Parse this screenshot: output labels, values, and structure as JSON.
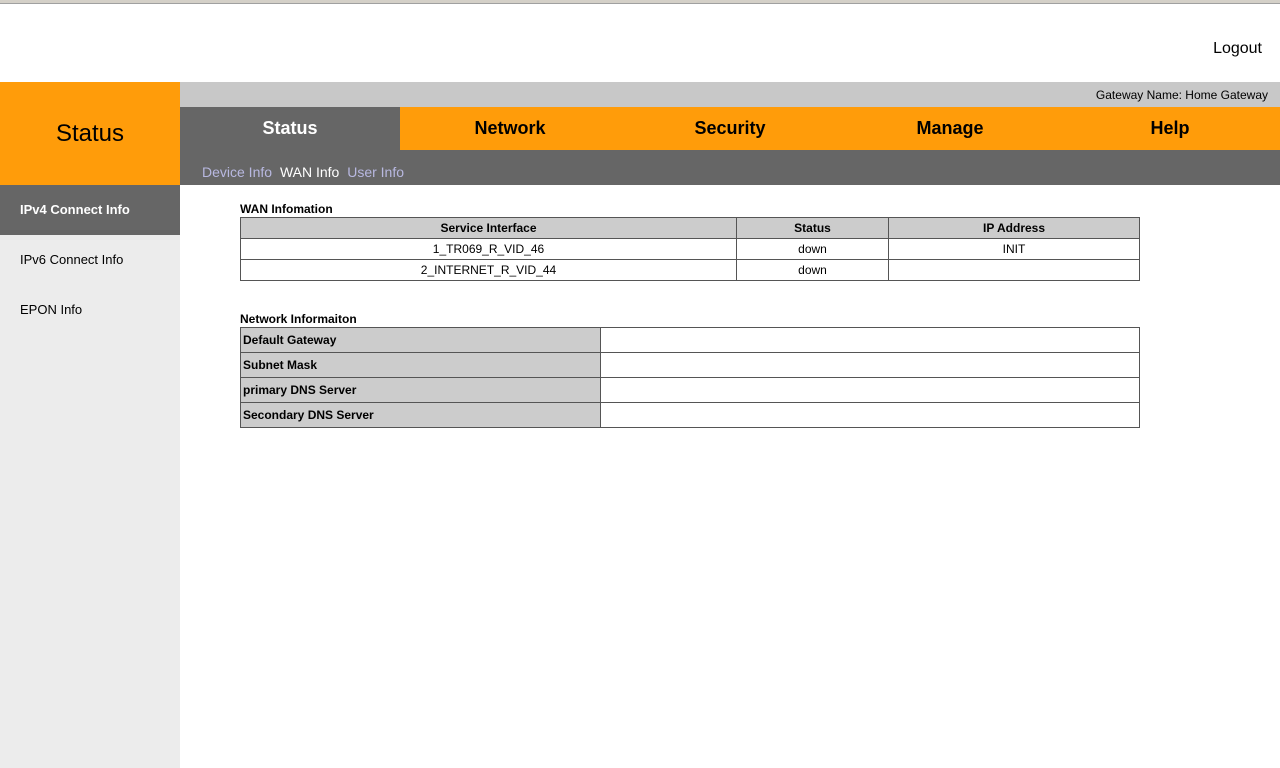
{
  "header": {
    "logout": "Logout",
    "gateway_name": "Gateway Name: Home Gateway"
  },
  "brand": "Status",
  "tabs": [
    {
      "label": "Status",
      "active": true
    },
    {
      "label": "Network"
    },
    {
      "label": "Security"
    },
    {
      "label": "Manage"
    },
    {
      "label": "Help"
    }
  ],
  "subtabs": [
    {
      "label": "Device Info"
    },
    {
      "label": "WAN Info",
      "active": true
    },
    {
      "label": "User Info"
    }
  ],
  "sidebar": [
    {
      "label": "IPv4 Connect Info",
      "active": true
    },
    {
      "label": "IPv6 Connect Info"
    },
    {
      "label": "EPON Info"
    }
  ],
  "wan": {
    "title": "WAN Infomation",
    "headers": [
      "Service Interface",
      "Status",
      "IP Address"
    ],
    "rows": [
      [
        "1_TR069_R_VID_46",
        "down",
        "INIT"
      ],
      [
        "2_INTERNET_R_VID_44",
        "down",
        ""
      ]
    ]
  },
  "network": {
    "title": "Network Informaiton",
    "rows": [
      {
        "label": "Default Gateway",
        "value": ""
      },
      {
        "label": "Subnet Mask",
        "value": ""
      },
      {
        "label": "primary DNS Server",
        "value": ""
      },
      {
        "label": "Secondary DNS Server",
        "value": ""
      }
    ]
  }
}
